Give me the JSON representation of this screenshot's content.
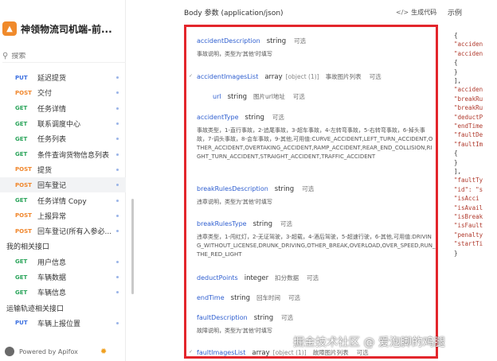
{
  "app": {
    "title": "神领物流司机端-前...",
    "search_placeholder": "搜索"
  },
  "nav": [
    {
      "kind": "endpoint",
      "method": "PUT",
      "name": "延迟提货"
    },
    {
      "kind": "endpoint",
      "method": "POST",
      "name": "交付"
    },
    {
      "kind": "endpoint",
      "method": "GET",
      "name": "任务详情"
    },
    {
      "kind": "endpoint",
      "method": "GET",
      "name": "联系调度中心"
    },
    {
      "kind": "endpoint",
      "method": "GET",
      "name": "任务列表"
    },
    {
      "kind": "endpoint",
      "method": "GET",
      "name": "条件查询货物信息列表"
    },
    {
      "kind": "endpoint",
      "method": "POST",
      "name": "提货"
    },
    {
      "kind": "endpoint",
      "method": "POST",
      "name": "回车登记",
      "active": true
    },
    {
      "kind": "endpoint",
      "method": "GET",
      "name": "任务详情 Copy"
    },
    {
      "kind": "endpoint",
      "method": "POST",
      "name": "上报异常"
    },
    {
      "kind": "endpoint",
      "method": "POST",
      "name": "回车登记(所有入参必..."
    },
    {
      "kind": "folder",
      "name": "我的相关接口"
    },
    {
      "kind": "endpoint",
      "method": "GET",
      "name": "用户信息"
    },
    {
      "kind": "endpoint",
      "method": "GET",
      "name": "车辆数据"
    },
    {
      "kind": "endpoint",
      "method": "GET",
      "name": "车辆信息"
    },
    {
      "kind": "folder",
      "name": "运输轨迹相关接口"
    },
    {
      "kind": "endpoint",
      "method": "PUT",
      "name": "车辆上报位置"
    }
  ],
  "footer": {
    "powered": "Powered by Apifox"
  },
  "header": {
    "body_title": "Body 参数 (application/json)",
    "gen_code": "生成代码",
    "example_tab": "示例"
  },
  "params": [
    {
      "name": "accidentDescription",
      "type": "string",
      "opt": "可选",
      "desc": "事故说明，类型为'其他'时填写"
    },
    {
      "name": "accidentImagesList",
      "type": "array",
      "extra": "[object (1)]",
      "tag": "事故图片列表",
      "opt": "可选"
    },
    {
      "name": "url",
      "type": "string",
      "tag": "图片url地址",
      "opt": "可选"
    },
    {
      "name": "accidentType",
      "type": "string",
      "opt": "可选",
      "desc": "事故类型，1-直行事故，2-追尾事故，3-超车事故，4-左转弯事故，5-右转弯事故，6-掉头事故，7-调头事故，8-会车事故，9-其他,可用值:CURVE_ACCIDENT,LEFT_TURN_ACCIDENT,OTHER_ACCIDENT,OVERTAKING_ACCIDENT,RAMP_ACCIDENT,REAR_END_COLLISION,RIGHT_TURN_ACCIDENT,STRAIGHT_ACCIDENT,TRAFFIC_ACCIDENT"
    },
    {
      "name": "breakRulesDescription",
      "type": "string",
      "opt": "可选",
      "desc": "违章说明，类型为'其他'时填写"
    },
    {
      "name": "breakRulesType",
      "type": "string",
      "opt": "可选",
      "desc": "违章类型，1-闯红灯，2-无证驾驶，3-超载，4-酒后驾驶，5-超速行驶，6-其他,可用值:DRIVING_WITHOUT_LICENSE,DRUNK_DRIVING,OTHER_BREAK,OVERLOAD,OVER_SPEED,RUN_THE_RED_LIGHT"
    },
    {
      "name": "deductPoints",
      "type": "integer",
      "tag": "扣分数据",
      "opt": "可选"
    },
    {
      "name": "endTime",
      "type": "string",
      "tag": "回车时间",
      "opt": "可选"
    },
    {
      "name": "faultDescription",
      "type": "string",
      "opt": "可选",
      "desc": "故障说明，类型为'其他'时填写"
    },
    {
      "name": "faultImagesList",
      "type": "array",
      "extra": "[object (1)]",
      "tag": "故障图片列表",
      "opt": "可选"
    }
  ],
  "json_lines": [
    "{",
    "  \"acciden",
    "  \"acciden",
    "    {",
    "    }",
    "  ],",
    "  \"acciden",
    "  \"breakRu",
    "  \"breakRu",
    "  \"deductP",
    "  \"endTime",
    "  \"faultDe",
    "  \"faultIm",
    "    {",
    "    }",
    "  ],",
    "  \"faultTy",
    "  \"id\": \"s",
    "  \"isAcci",
    "  \"isAvail",
    "  \"isBreak",
    "  \"isFault",
    "  \"penalty",
    "  \"startTi",
    "}"
  ],
  "watermark": "掘金技术社区 @ 爱泡脚的鸡腿"
}
